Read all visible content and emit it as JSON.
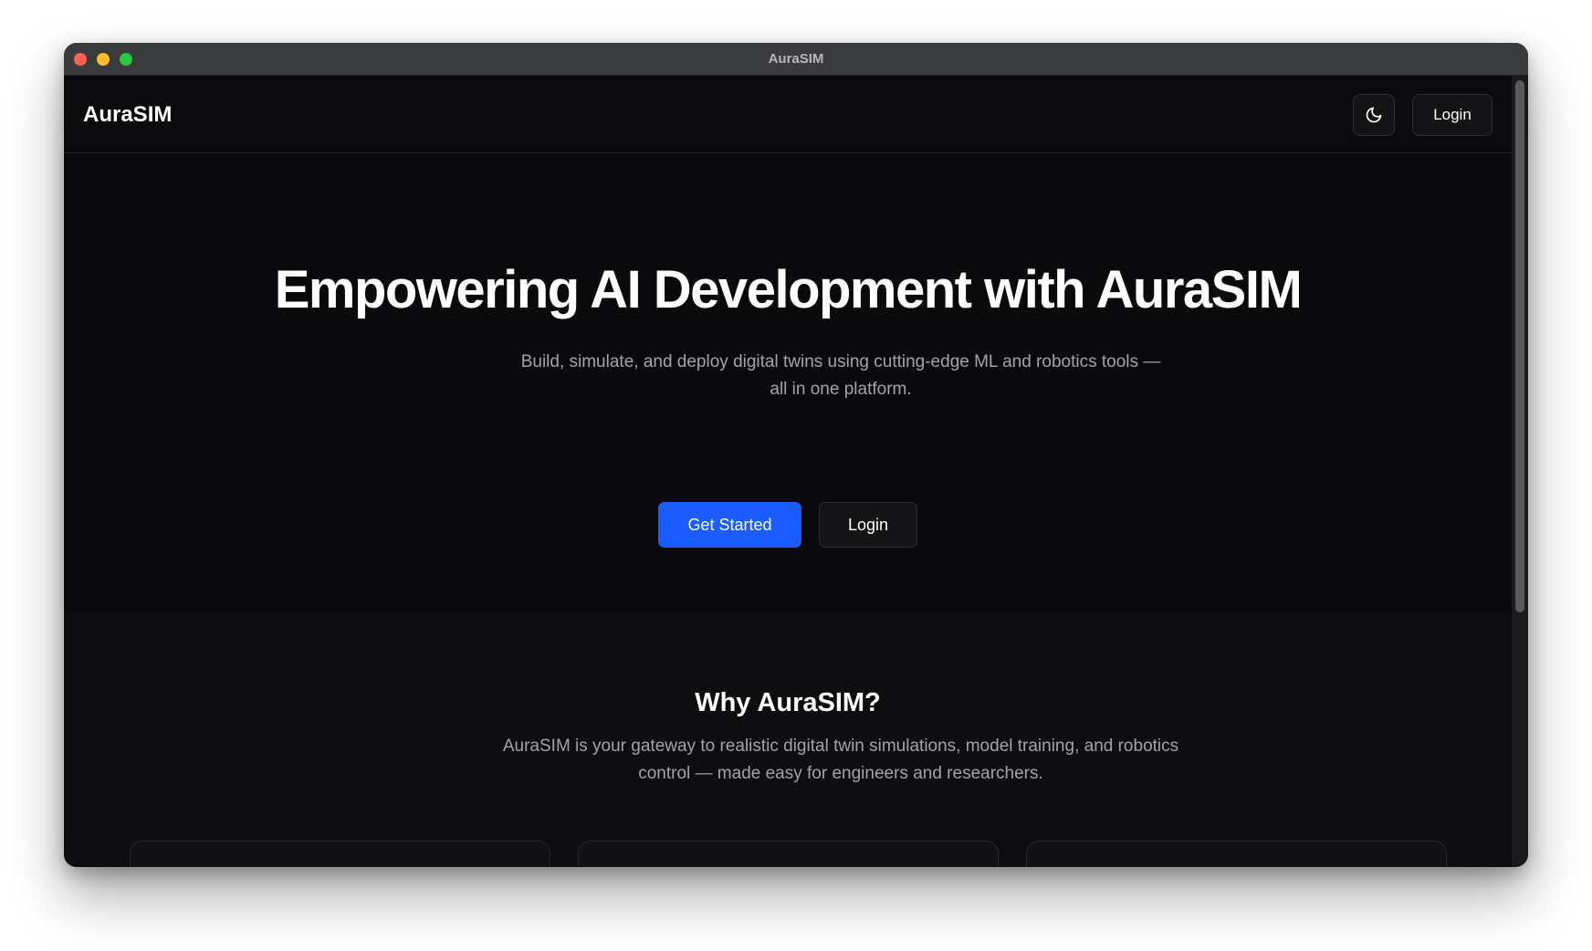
{
  "window": {
    "title": "AuraSIM"
  },
  "navbar": {
    "brand": "AuraSIM",
    "theme_toggle_icon": "moon-icon",
    "login_label": "Login"
  },
  "hero": {
    "title": "Empowering AI Development with AuraSIM",
    "subtitle": "Build, simulate, and deploy digital twins using cutting-edge ML and robotics tools — all in one platform.",
    "primary_button": "Get Started",
    "secondary_button": "Login"
  },
  "why": {
    "title": "Why AuraSIM?",
    "text": "AuraSIM is your gateway to realistic digital twin simulations, model training, and robotics control — made easy for engineers and researchers."
  },
  "colors": {
    "accent": "#1a5cff",
    "background": "#0b0b0d",
    "muted_text": "#a3a3a8"
  }
}
